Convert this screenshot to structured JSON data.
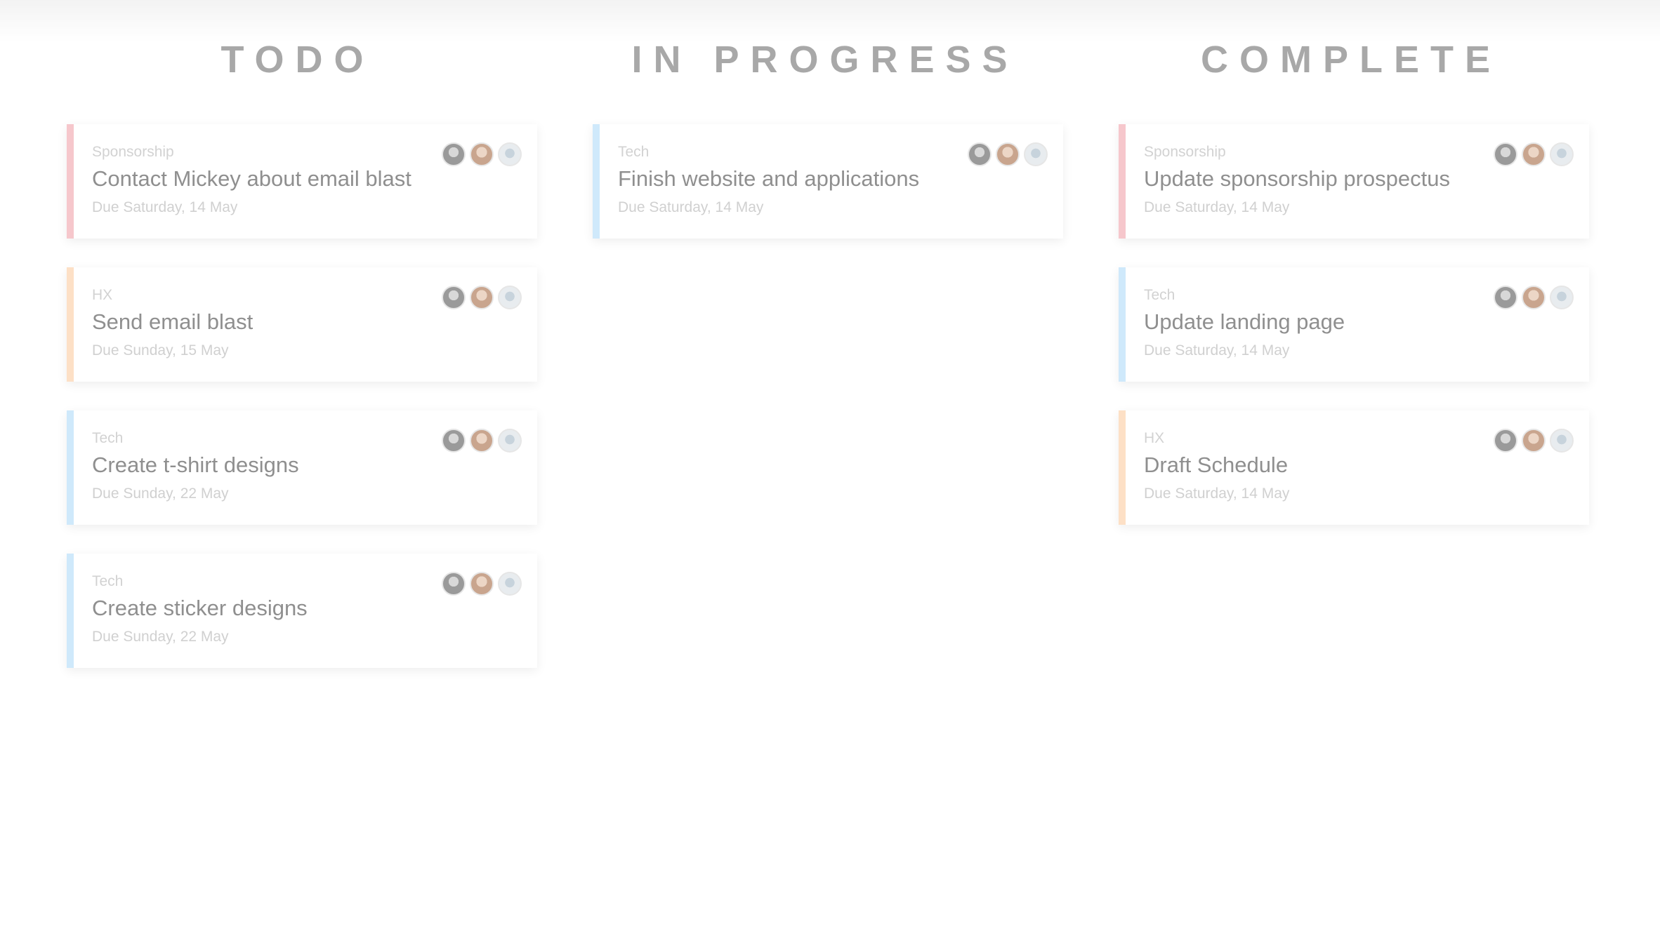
{
  "columns": [
    {
      "title": "TODO",
      "cards": [
        {
          "category": "Sponsorship",
          "title": "Contact Mickey about email blast",
          "due": "Due Saturday, 14 May",
          "color": "#f6c7cc"
        },
        {
          "category": "HX",
          "title": "Send email blast",
          "due": "Due Sunday, 15 May",
          "color": "#fde0c6"
        },
        {
          "category": "Tech",
          "title": "Create t-shirt designs",
          "due": "Due Sunday, 22 May",
          "color": "#cfe9fb"
        },
        {
          "category": "Tech",
          "title": "Create sticker designs",
          "due": "Due Sunday, 22 May",
          "color": "#cfe9fb"
        }
      ]
    },
    {
      "title": "IN PROGRESS",
      "cards": [
        {
          "category": "Tech",
          "title": "Finish website and applications",
          "due": "Due Saturday, 14 May",
          "color": "#cfe9fb"
        }
      ]
    },
    {
      "title": "COMPLETE",
      "cards": [
        {
          "category": "Sponsorship",
          "title": "Update sponsorship prospectus",
          "due": "Due Saturday, 14 May",
          "color": "#f6c7cc"
        },
        {
          "category": "Tech",
          "title": "Update landing page",
          "due": "Due Saturday, 14 May",
          "color": "#cfe9fb"
        },
        {
          "category": "HX",
          "title": "Draft Schedule",
          "due": "Due Saturday, 14 May",
          "color": "#fde0c6"
        }
      ]
    }
  ],
  "avatar_icons": [
    "avatar-icon",
    "avatar-icon",
    "avatar-icon"
  ]
}
